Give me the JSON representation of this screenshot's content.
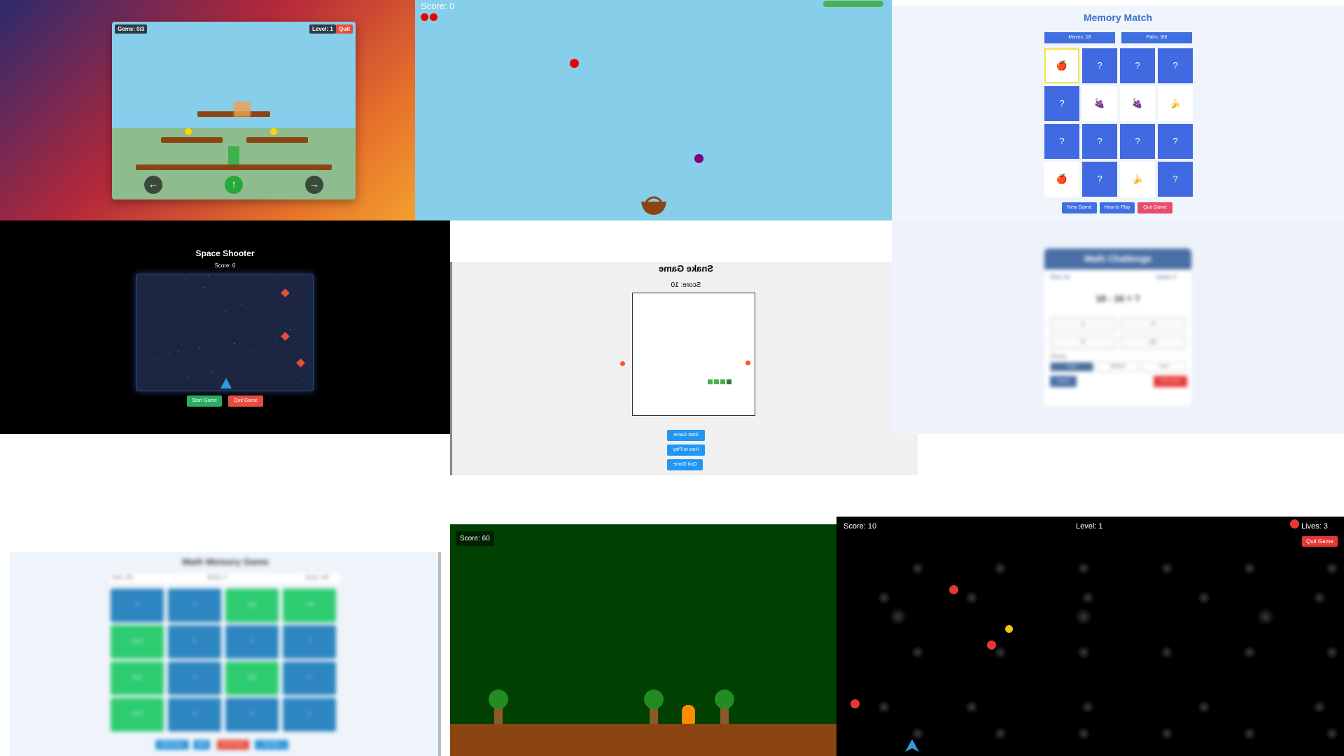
{
  "platformer": {
    "gems_label": "Gems: 0/3",
    "level_label": "Level: 1",
    "quit_label": "Quit",
    "left_arrow": "←",
    "jump_arrow": "↑",
    "right_arrow": "→",
    "colors": {
      "sky": "#87ceeb",
      "grass": "#8fbc8f",
      "platform": "#8b4513",
      "gem": "#ffd700"
    }
  },
  "catcher": {
    "score_label": "Score: 0",
    "lives": 2,
    "colors": {
      "sky": "#87ceeb",
      "basket": "#8b4513"
    }
  },
  "memory_match": {
    "title": "Memory Match",
    "moves_label": "Moves: 18",
    "pairs_label": "Pairs: 3/8",
    "cards": [
      "🍎",
      "?",
      "?",
      "?",
      "?",
      "🍇",
      "🍇",
      "🍌",
      "?",
      "?",
      "?",
      "?",
      "🍎",
      "?",
      "🍌",
      "?"
    ],
    "buttons": {
      "new_game": "New Game",
      "how_to_play": "How to Play",
      "quit_game": "Quit Game"
    },
    "colors": {
      "card_back": "#4169e1",
      "quit": "#e84c6a"
    }
  },
  "space_shooter": {
    "title": "Space Shooter",
    "score_label": "Score: 0",
    "start_label": "Start Game",
    "quit_label": "Quit Game",
    "colors": {
      "start": "#27ae60",
      "quit": "#e74c3c",
      "ship": "#3498db"
    }
  },
  "snake": {
    "title": "Snake Game",
    "score_label": "Score: 10",
    "buttons": {
      "start": "Start Game",
      "how_to_play": "How to Play",
      "quit": "Quit Game"
    },
    "colors": {
      "snake": "#4caf50",
      "food": "#ff5722",
      "button": "#2196f3"
    }
  },
  "math_challenge": {
    "title": "Math Challenge",
    "time_label": "Time: 9s",
    "score_label": "Score: 0",
    "question": "18 - 16 = ?",
    "options": [
      "1",
      "2",
      "4",
      "10"
    ],
    "difficulty_label": "Difficulty:",
    "levels": [
      "Easy",
      "Medium",
      "Hard"
    ],
    "submit_label": "Submit",
    "end_label": "End Game"
  },
  "math_memory": {
    "title": "Math Memory Game",
    "pairs_label": "Pairs: 3/8",
    "moves_label": "Moves: 4",
    "score_label": "Score: 100",
    "tiles": [
      "?",
      "?",
      "3+3",
      "7+6",
      "11+6",
      "?",
      "?",
      "?",
      "6+9",
      "?",
      "6+4",
      "?",
      "10+2",
      "?",
      "?",
      "?"
    ],
    "buttons": [
      "New Game",
      "Quit",
      "Reset Game",
      "Get Hint"
    ]
  },
  "forest_runner": {
    "score_label": "Score: 60",
    "colors": {
      "sky": "#004000",
      "ground": "#8b4513",
      "runner": "#ff8c00"
    }
  },
  "space_dodger": {
    "score_label": "Score: 10",
    "level_label": "Level: 1",
    "lives_label": "Lives: 3",
    "quit_label": "Quit Game",
    "colors": {
      "rock": "#e53935",
      "coin": "#f5c518",
      "ship": "#3498db"
    }
  }
}
